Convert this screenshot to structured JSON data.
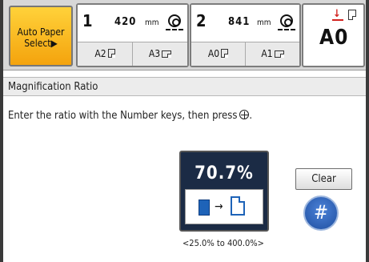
{
  "tray_selector": {
    "auto_paper_select": {
      "line1": "Auto Paper",
      "line2": "Select▶"
    },
    "trays": [
      {
        "number": "1",
        "length": "420",
        "unit": "mm",
        "sizes": [
          "A2",
          "A3"
        ]
      },
      {
        "number": "2",
        "length": "841",
        "unit": "mm",
        "sizes": [
          "A0",
          "A1"
        ]
      }
    ],
    "original": {
      "size": "A0",
      "icons": [
        "download-arrow-icon",
        "paper-icon"
      ],
      "accent_color": "#d2231f"
    }
  },
  "dialog": {
    "title": "Magnification Ratio",
    "instruction": "Enter the ratio with the Number keys, then press",
    "ratio_value": "70.7%",
    "range": "<25.0% to 400.0%>",
    "clear_label": "Clear",
    "hash_label": "#",
    "colors": {
      "ratio_panel": "#1b2b45",
      "paper_blue": "#1e63b8",
      "auto_button": "#f4a30d"
    }
  }
}
